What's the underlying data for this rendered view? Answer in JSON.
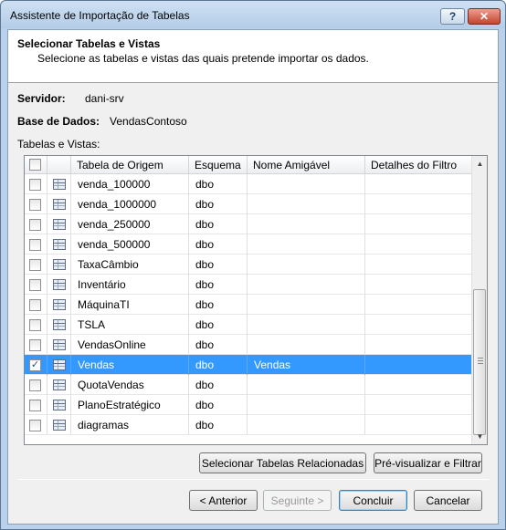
{
  "window": {
    "title": "Assistente de Importação de Tabelas",
    "help_glyph": "?",
    "close_glyph": "✕"
  },
  "header": {
    "title": "Selecionar Tabelas e Vistas",
    "subtitle": "Selecione as tabelas e vistas das quais pretende importar os dados."
  },
  "server": {
    "label": "Servidor:",
    "value": "dani-srv"
  },
  "database": {
    "label": "Base de Dados:",
    "value": "VendasContoso"
  },
  "tables_label": "Tabelas e Vistas:",
  "grid": {
    "columns": [
      "Tabela de Origem",
      "Esquema",
      "Nome Amigável",
      "Detalhes do Filtro"
    ],
    "rows": [
      {
        "checked": false,
        "source": "venda_100000",
        "schema": "dbo",
        "friendly": ""
      },
      {
        "checked": false,
        "source": "venda_1000000",
        "schema": "dbo",
        "friendly": ""
      },
      {
        "checked": false,
        "source": "venda_250000",
        "schema": "dbo",
        "friendly": ""
      },
      {
        "checked": false,
        "source": "venda_500000",
        "schema": "dbo",
        "friendly": ""
      },
      {
        "checked": false,
        "source": "TaxaCâmbio",
        "schema": "dbo",
        "friendly": ""
      },
      {
        "checked": false,
        "source": "Inventário",
        "schema": "dbo",
        "friendly": ""
      },
      {
        "checked": false,
        "source": "MáquinaTI",
        "schema": "dbo",
        "friendly": ""
      },
      {
        "checked": false,
        "source": "TSLA",
        "schema": "dbo",
        "friendly": ""
      },
      {
        "checked": false,
        "source": "VendasOnline",
        "schema": "dbo",
        "friendly": ""
      },
      {
        "checked": true,
        "source": "Vendas",
        "schema": "dbo",
        "friendly": "Vendas"
      },
      {
        "checked": false,
        "source": "QuotaVendas",
        "schema": "dbo",
        "friendly": ""
      },
      {
        "checked": false,
        "source": "PlanoEstratégico",
        "schema": "dbo",
        "friendly": ""
      },
      {
        "checked": false,
        "source": "diagramas",
        "schema": "dbo",
        "friendly": ""
      }
    ]
  },
  "buttons": {
    "related": "Selecionar Tabelas Relacionadas",
    "preview": "Pré-visualizar e Filtrar",
    "back": "< Anterior",
    "next": "Seguinte >",
    "finish": "Concluir",
    "cancel": "Cancelar"
  },
  "colors": {
    "selection": "#3399ff",
    "title_bar": "#b9d1ea"
  },
  "icons": [
    "help-icon",
    "close-icon",
    "table-icon",
    "checkbox-icon",
    "scroll-up-icon",
    "scroll-down-icon"
  ]
}
